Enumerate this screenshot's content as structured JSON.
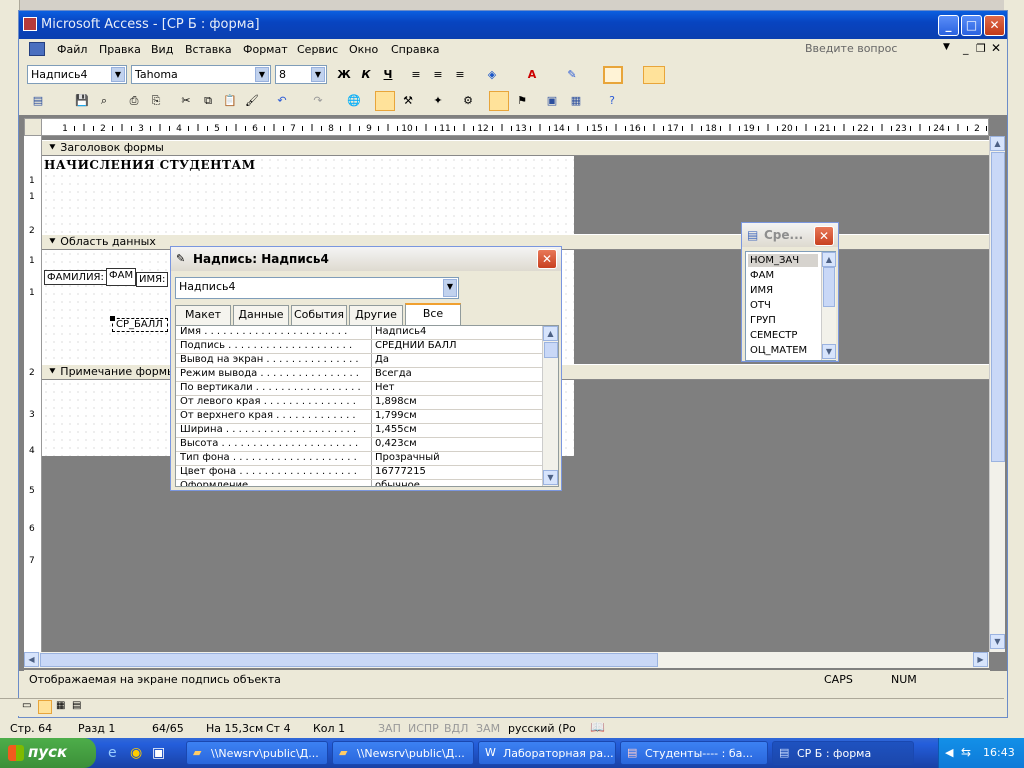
{
  "app": {
    "title": "Microsoft Access - [СР Б : форма]"
  },
  "menu": {
    "items": [
      "Файл",
      "Правка",
      "Вид",
      "Вставка",
      "Формат",
      "Сервис",
      "Окно",
      "Справка"
    ],
    "help_placeholder": "Введите вопрос"
  },
  "format_toolbar": {
    "object": "Надпись4",
    "font": "Tahoma",
    "size": "8",
    "bold": "Ж",
    "italic": "К",
    "underline": "Ч"
  },
  "ruler": {
    "numbers": [
      "1",
      "2",
      "3",
      "4",
      "5",
      "6",
      "7",
      "8",
      "9",
      "10",
      "11",
      "12",
      "13",
      "14",
      "15",
      "16",
      "17",
      "18",
      "19",
      "20",
      "21",
      "22",
      "23",
      "24",
      "2"
    ],
    "vnumbers": [
      "1",
      "1",
      "2",
      "1",
      "1",
      "2",
      "3",
      "4",
      "5",
      "6",
      "7"
    ]
  },
  "form": {
    "header_section": "Заголовок формы",
    "title": "НАЧИСЛЕНИЯ СТУДЕНТАМ",
    "detail_section": "Область данных",
    "label_fam": "ФАМИЛИЯ:",
    "field_fam": "ФАМ",
    "label_name": "ИМЯ:",
    "label_sr": "СР_БАЛЛ",
    "footer_section": "Примечание формы"
  },
  "props": {
    "title": "Надпись: Надпись4",
    "selected": "Надпись4",
    "tabs": [
      "Макет",
      "Данные",
      "События",
      "Другие",
      "Все"
    ],
    "rows": [
      {
        "name": "Имя . . . . . . . . . . . . . . . . . . . . . . .",
        "value": "Надпись4"
      },
      {
        "name": "Подпись . . . . . . . . . . . . . . . . . . . .",
        "value": "СРЕДНИЙ БАЛЛ"
      },
      {
        "name": "Вывод на экран . . . . . . . . . . . . . . .",
        "value": "Да"
      },
      {
        "name": "Режим вывода . . . . . . . . . . . . . . . .",
        "value": "Всегда"
      },
      {
        "name": "По вертикали . . . . . . . . . . . . . . . . .",
        "value": "Нет"
      },
      {
        "name": "От левого края . . . . . . . . . . . . . . .",
        "value": "1,898см"
      },
      {
        "name": "От верхнего края . . . . . . . . . . . . .",
        "value": "1,799см"
      },
      {
        "name": "Ширина . . . . . . . . . . . . . . . . . . . . .",
        "value": "1,455см"
      },
      {
        "name": "Высота . . . . . . . . . . . . . . . . . . . . . .",
        "value": "0,423см"
      },
      {
        "name": "Тип фона . . . . . . . . . . . . . . . . . . . .",
        "value": "Прозрачный"
      },
      {
        "name": "Цвет фона . . . . . . . . . . . . . . . . . . .",
        "value": "16777215"
      },
      {
        "name": "Оформление . . . . . . . . . . . . . . . . .",
        "value": "обычное"
      }
    ]
  },
  "fieldlist": {
    "title": "Сре...",
    "fields": [
      "НОМ_ЗАЧ",
      "ФАМ",
      "ИМЯ",
      "ОТЧ",
      "ГРУП",
      "СЕМЕСТР",
      "ОЦ_МАТЕМ"
    ]
  },
  "statusbar": {
    "text": "Отображаемая на экране подпись объекта",
    "caps": "CAPS",
    "num": "NUM"
  },
  "word_status": {
    "page": "Стр. 64",
    "section": "Разд 1",
    "pages": "64/65",
    "at": "На 15,3см",
    "line": "Ст 4",
    "col": "Кол 1",
    "rec": "ЗАП",
    "trk": "ИСПР",
    "ext": "ВДЛ",
    "ovr": "ЗАМ",
    "lang": "русский (Ро"
  },
  "taskbar": {
    "start": "пуск",
    "tasks": [
      "\\\\Newsrv\\public\\Д...",
      "\\\\Newsrv\\public\\Д...",
      "Лабораторная ра...",
      "Студенты---- : ба...",
      "СР Б : форма"
    ],
    "clock": "16:43"
  }
}
